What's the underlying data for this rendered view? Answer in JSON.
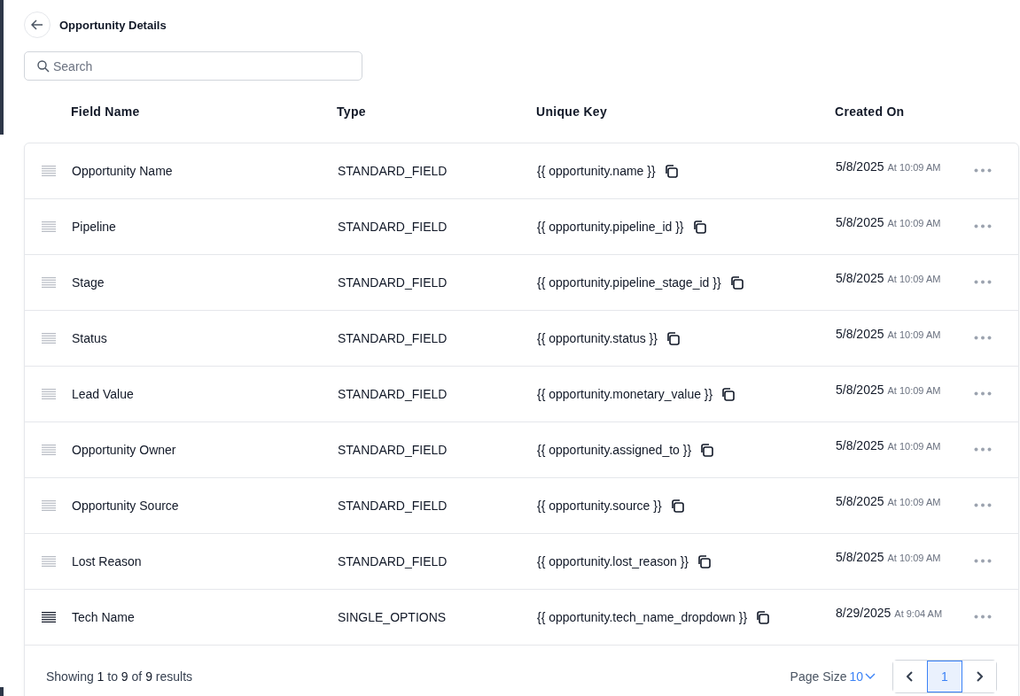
{
  "header": {
    "title": "Opportunity Details"
  },
  "search": {
    "placeholder": "Search"
  },
  "table": {
    "columns": [
      "Field Name",
      "Type",
      "Unique Key",
      "Created On"
    ],
    "rows": [
      {
        "name": "Opportunity Name",
        "type": "STANDARD_FIELD",
        "key": "{{ opportunity.name }}",
        "date": "5/8/2025",
        "time": "At 10:09 AM",
        "hovered": false
      },
      {
        "name": "Pipeline",
        "type": "STANDARD_FIELD",
        "key": "{{ opportunity.pipeline_id }}",
        "date": "5/8/2025",
        "time": "At 10:09 AM",
        "hovered": false
      },
      {
        "name": "Stage",
        "type": "STANDARD_FIELD",
        "key": "{{ opportunity.pipeline_stage_id }}",
        "date": "5/8/2025",
        "time": "At 10:09 AM",
        "hovered": false
      },
      {
        "name": "Status",
        "type": "STANDARD_FIELD",
        "key": "{{ opportunity.status }}",
        "date": "5/8/2025",
        "time": "At 10:09 AM",
        "hovered": false
      },
      {
        "name": "Lead Value",
        "type": "STANDARD_FIELD",
        "key": "{{ opportunity.monetary_value }}",
        "date": "5/8/2025",
        "time": "At 10:09 AM",
        "hovered": false
      },
      {
        "name": "Opportunity Owner",
        "type": "STANDARD_FIELD",
        "key": "{{ opportunity.assigned_to }}",
        "date": "5/8/2025",
        "time": "At 10:09 AM",
        "hovered": false
      },
      {
        "name": "Opportunity Source",
        "type": "STANDARD_FIELD",
        "key": "{{ opportunity.source }}",
        "date": "5/8/2025",
        "time": "At 10:09 AM",
        "hovered": false
      },
      {
        "name": "Lost Reason",
        "type": "STANDARD_FIELD",
        "key": "{{ opportunity.lost_reason }}",
        "date": "5/8/2025",
        "time": "At 10:09 AM",
        "hovered": false
      },
      {
        "name": "Tech Name",
        "type": "SINGLE_OPTIONS",
        "key": "{{ opportunity.tech_name_dropdown }}",
        "date": "8/29/2025",
        "time": "At 9:04 AM",
        "hovered": true
      }
    ]
  },
  "footer": {
    "summary": "Showing **1** to **9** of **9** results",
    "page_size_label": "Page Size",
    "page_size": "10",
    "pages": [
      {
        "label": "1",
        "selected": true
      }
    ]
  }
}
